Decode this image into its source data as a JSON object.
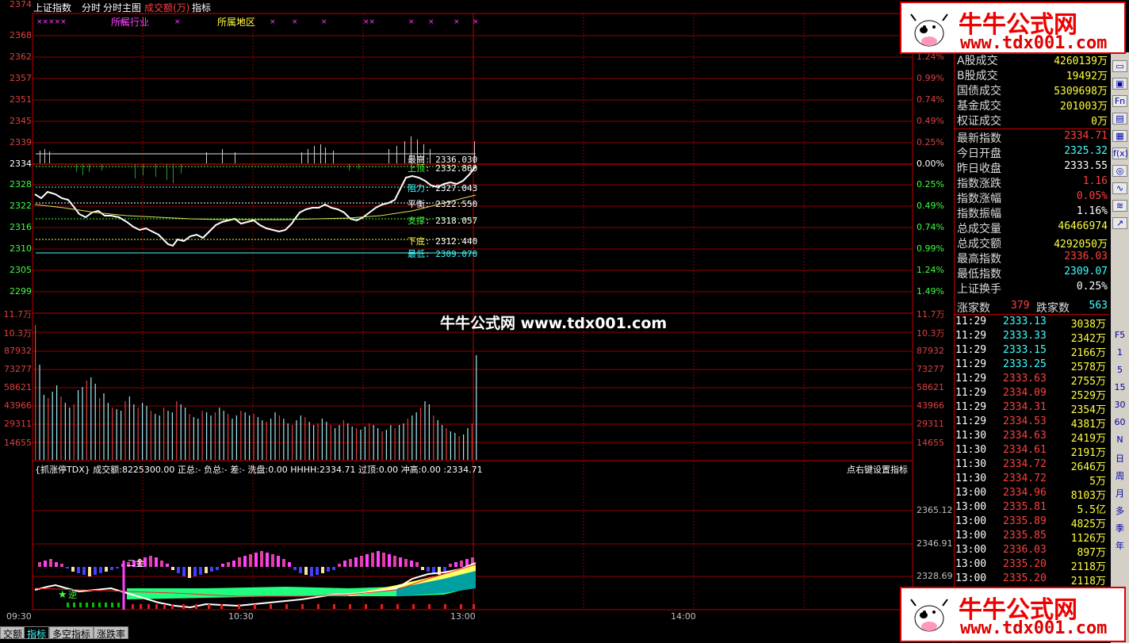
{
  "topbar": {
    "index_name": "上证指数",
    "mode": "分时",
    "main_chart": "分时主图",
    "amount": "成交额(万)",
    "indicator": "指标"
  },
  "overlay": {
    "industry": "所属行业",
    "region": "所属地区"
  },
  "price_axis": [
    "2374",
    "2368",
    "2362",
    "2357",
    "2351",
    "2345",
    "2339",
    "2334",
    "2328",
    "2322",
    "2316",
    "2310",
    "2305",
    "2299"
  ],
  "pct_axis": [
    "1.24%",
    "0.99%",
    "0.74%",
    "0.49%",
    "0.25%",
    "0.00%",
    "0.25%",
    "0.49%",
    "0.74%",
    "0.99%",
    "1.24%",
    "1.49%"
  ],
  "vol_axis": [
    "11.7万",
    "10.3万",
    "87932",
    "73277",
    "58621",
    "43966",
    "29311",
    "14655"
  ],
  "ind_axis": [
    "2365.12",
    "2346.91",
    "2328.69"
  ],
  "time_axis": [
    "09:30",
    "10:30",
    "13:00",
    "14:00"
  ],
  "levels": [
    {
      "label": "最高",
      "value": "2336.030",
      "color": "#ffffff"
    },
    {
      "label": "上顶",
      "value": "2332.860",
      "color": "#40ff40"
    },
    {
      "label": "阻力",
      "value": "2327.043",
      "color": "#40ffff"
    },
    {
      "label": "平衡",
      "value": "2322.550",
      "color": "#ffffff"
    },
    {
      "label": "支撑",
      "value": "2318.057",
      "color": "#40ff40"
    },
    {
      "label": "下底",
      "value": "2312.440",
      "color": "#ffff40"
    },
    {
      "label": "最低",
      "value": "2309.070",
      "color": "#40ffff"
    }
  ],
  "watermark": "牛牛公式网 www.tdx001.com",
  "indicator_line": {
    "name": "{抓涨停TDX}",
    "amount": "成交额:8225300.00",
    "zheng": "正总:-",
    "fu": "负总:-",
    "cha": "差:-",
    "xipan": "洗盘:0.00",
    "hhhh": "HHHH:2334.71",
    "guoding": "过顶:0.00",
    "chonggao": "冲高:0.00",
    "last": ":2334.71",
    "hint": "点右键设置指标"
  },
  "ind_marks": {
    "erjin": "二金",
    "ni": "逆"
  },
  "bottom_tabs": [
    "交额",
    "指标",
    "多空指标",
    "涨跌率"
  ],
  "stats": [
    {
      "label": "A股成交",
      "value": "4260139万",
      "color": "#ffff40"
    },
    {
      "label": "B股成交",
      "value": "19492万",
      "color": "#ffff40"
    },
    {
      "label": "国债成交",
      "value": "5309698万",
      "color": "#ffff40"
    },
    {
      "label": "基金成交",
      "value": "201003万",
      "color": "#ffff40"
    },
    {
      "label": "权证成交",
      "value": "0万",
      "color": "#ffff40"
    },
    {
      "label": "最新指数",
      "value": "2334.71",
      "color": "#ff4040"
    },
    {
      "label": "今日开盘",
      "value": "2325.32",
      "color": "#40ffff"
    },
    {
      "label": "昨日收盘",
      "value": "2333.55",
      "color": "#ffffff"
    },
    {
      "label": "指数涨跌",
      "value": "1.16",
      "color": "#ff4040"
    },
    {
      "label": "指数涨幅",
      "value": "0.05%",
      "color": "#ff4040"
    },
    {
      "label": "指数振幅",
      "value": "1.16%",
      "color": "#ffffff"
    },
    {
      "label": "总成交量",
      "value": "46466974",
      "color": "#ffff40"
    },
    {
      "label": "总成交额",
      "value": "4292050万",
      "color": "#ffff40"
    },
    {
      "label": "最高指数",
      "value": "2336.03",
      "color": "#ff4040"
    },
    {
      "label": "最低指数",
      "value": "2309.07",
      "color": "#40ffff"
    },
    {
      "label": "上证换手",
      "value": "0.25%",
      "color": "#ffffff"
    }
  ],
  "updown": {
    "up_label": "涨家数",
    "up": "379",
    "down_label": "跌家数",
    "down": "563"
  },
  "ticks": [
    {
      "t": "11:29",
      "p": "2333.13",
      "v": "3038万",
      "c": "#40ffff"
    },
    {
      "t": "11:29",
      "p": "2333.33",
      "v": "2342万",
      "c": "#40ffff"
    },
    {
      "t": "11:29",
      "p": "2333.15",
      "v": "2166万",
      "c": "#40ffff"
    },
    {
      "t": "11:29",
      "p": "2333.25",
      "v": "2578万",
      "c": "#40ffff"
    },
    {
      "t": "11:29",
      "p": "2333.63",
      "v": "2755万",
      "c": "#ff4040"
    },
    {
      "t": "11:29",
      "p": "2334.09",
      "v": "2529万",
      "c": "#ff4040"
    },
    {
      "t": "11:29",
      "p": "2334.31",
      "v": "2354万",
      "c": "#ff4040"
    },
    {
      "t": "11:29",
      "p": "2334.53",
      "v": "4381万",
      "c": "#ff4040"
    },
    {
      "t": "11:30",
      "p": "2334.63",
      "v": "2419万",
      "c": "#ff4040"
    },
    {
      "t": "11:30",
      "p": "2334.61",
      "v": "2191万",
      "c": "#ff4040"
    },
    {
      "t": "11:30",
      "p": "2334.72",
      "v": "2646万",
      "c": "#ff4040"
    },
    {
      "t": "11:30",
      "p": "2334.72",
      "v": "5万",
      "c": "#ff4040"
    },
    {
      "t": "13:00",
      "p": "2334.96",
      "v": "8103万",
      "c": "#ff4040"
    },
    {
      "t": "13:00",
      "p": "2335.81",
      "v": "5.5亿",
      "c": "#ff4040"
    },
    {
      "t": "13:00",
      "p": "2335.89",
      "v": "4825万",
      "c": "#ff4040"
    },
    {
      "t": "13:00",
      "p": "2335.85",
      "v": "1126万",
      "c": "#ff4040"
    },
    {
      "t": "13:00",
      "p": "2336.03",
      "v": "897万",
      "c": "#ff4040"
    },
    {
      "t": "13:00",
      "p": "2335.20",
      "v": "2118万",
      "c": "#ff4040"
    },
    {
      "t": "13:00",
      "p": "2335.20",
      "v": "2118万",
      "c": "#ff4040"
    }
  ],
  "toolstrip": [
    "F5",
    "1",
    "5",
    "15",
    "30",
    "60",
    "N",
    "日",
    "周",
    "月",
    "多",
    "季",
    "年"
  ],
  "ad": {
    "title": "牛牛公式网",
    "url": "www.tdx001.com"
  }
}
